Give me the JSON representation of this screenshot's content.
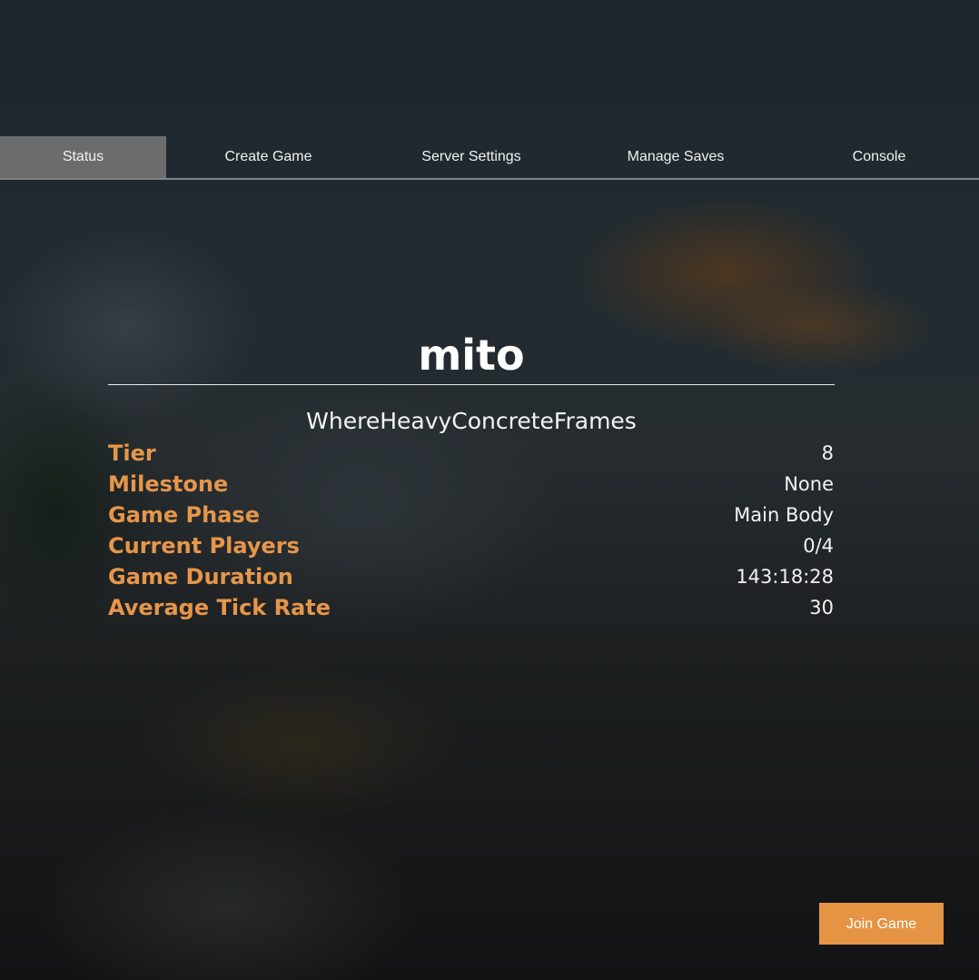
{
  "tabs": [
    {
      "label": "Status",
      "active": true
    },
    {
      "label": "Create Game",
      "active": false
    },
    {
      "label": "Server Settings",
      "active": false
    },
    {
      "label": "Manage Saves",
      "active": false
    },
    {
      "label": "Console",
      "active": false
    }
  ],
  "server": {
    "name": "mito",
    "session_name": "WhereHeavyConcreteFrames"
  },
  "stats": [
    {
      "label": "Tier",
      "value": "8"
    },
    {
      "label": "Milestone",
      "value": "None"
    },
    {
      "label": "Game Phase",
      "value": "Main Body"
    },
    {
      "label": "Current Players",
      "value": "0/4"
    },
    {
      "label": "Game Duration",
      "value": "143:18:28"
    },
    {
      "label": "Average Tick Rate",
      "value": "30"
    }
  ],
  "actions": {
    "join_label": "Join Game"
  },
  "colors": {
    "accent": "#e59444",
    "label": "#e6964a",
    "active_tab": "#787878"
  }
}
